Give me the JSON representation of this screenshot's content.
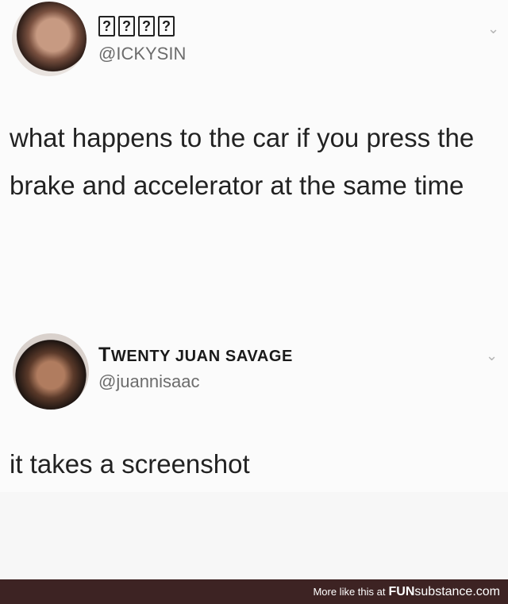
{
  "tweet1": {
    "display_name_glyphs": [
      "?",
      "?",
      "?",
      "?"
    ],
    "handle": "@ICKYSIN",
    "text": "what happens to the car if you press the brake and accelerator at the same time"
  },
  "tweet2": {
    "display_name_first": "T",
    "display_name_rest": "wenty Juan Savage",
    "handle": "@juannisaac",
    "text": "it takes a screenshot"
  },
  "footer": {
    "prefix": "More like this at",
    "brand_bold": "FUN",
    "brand_rest": "substance.com",
    "background_color": "#3d2323"
  },
  "icons": {
    "chevron": "chevron-down-icon"
  }
}
